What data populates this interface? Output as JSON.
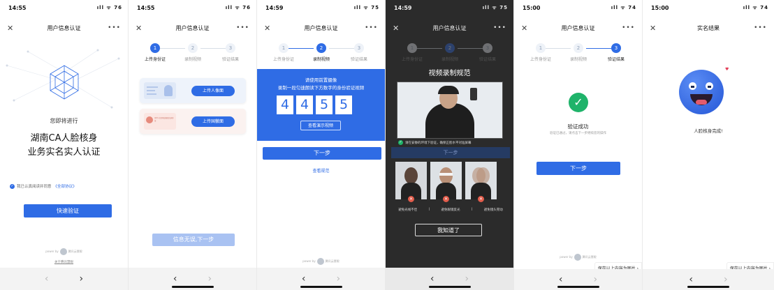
{
  "screens": [
    {
      "time": "14:55",
      "signal": "ıll ᯤ 76",
      "title": "用户信息认证",
      "intro": "您即将进行",
      "headline1": "湖南CA人脸核身",
      "headline2": "业务实名实人认证",
      "agree_prefix": "我已认真阅读并同意",
      "agree_link": "《全部协议》",
      "button": "快速验证",
      "powered": "power by",
      "powered_brand": "腾讯云慧眼",
      "footer_link": "关于腾讯慧眼",
      "back": "‹",
      "forward": "›"
    },
    {
      "time": "14:55",
      "signal": "ıll ᯤ 76",
      "title": "用户信息认证",
      "steps": [
        "上传身份证",
        "录制视频",
        "验证结果"
      ],
      "upload_front": "上传人像面",
      "upload_back": "上传国徽面",
      "id_card_text": "中华人民共和国居民身份证",
      "button": "信息无误,下一步",
      "back": "‹",
      "forward": "›"
    },
    {
      "time": "14:59",
      "signal": "ıll ᯤ 75",
      "title": "用户信息认证",
      "steps": [
        "上传身份证",
        "录制视频",
        "验证结果"
      ],
      "instruction1": "请使用前置摄像",
      "instruction2": "录制一段匀速朗读下方数字的身份验证视频",
      "digits": [
        "4",
        "4",
        "5",
        "5"
      ],
      "demo_button": "查看演示视频",
      "next_button": "下一步",
      "spec_link": "查看规范",
      "powered": "power by",
      "powered_brand": "腾讯云慧眼",
      "back": "‹",
      "forward": "›"
    },
    {
      "time": "14:59",
      "signal": "ıll ᯤ 75",
      "title": "用户信息认证",
      "steps": [
        "上传身份证",
        "录制视频",
        "验证结果"
      ],
      "modal_title": "视频录制规范",
      "tip": "请在安静的环境下验证，确保正脸水平对准屏幕",
      "next_ghost": "下一步",
      "warnings": [
        "避免光线不佳",
        "避免眼镜反光",
        "避免镜头晃动"
      ],
      "sep": "|",
      "ok_button": "我知道了",
      "back": "‹",
      "forward": "›"
    },
    {
      "time": "15:00",
      "signal": "ıll ᯤ 74",
      "title": "用户信息认证",
      "steps": [
        "上传身份证",
        "录制视频",
        "验证结果"
      ],
      "success_title": "验证成功",
      "success_sub": "验证已通过，请点击下一步继续您的操作",
      "next_button": "下一步",
      "powered": "power by",
      "powered_brand": "腾讯云慧眼",
      "save_chip": "保存以上内容为图片 ›",
      "back": "‹",
      "forward": "›"
    },
    {
      "time": "15:00",
      "signal": "ıll ᯤ 74",
      "title": "实名结果",
      "result": "人脸核身完成!",
      "save_chip": "保存以上内容为图片 ›",
      "back": "‹",
      "forward": "›"
    }
  ],
  "colors": {
    "accent": "#2f6ce5",
    "success": "#1fb36a",
    "dark_overlay": "#2b2b2b"
  }
}
